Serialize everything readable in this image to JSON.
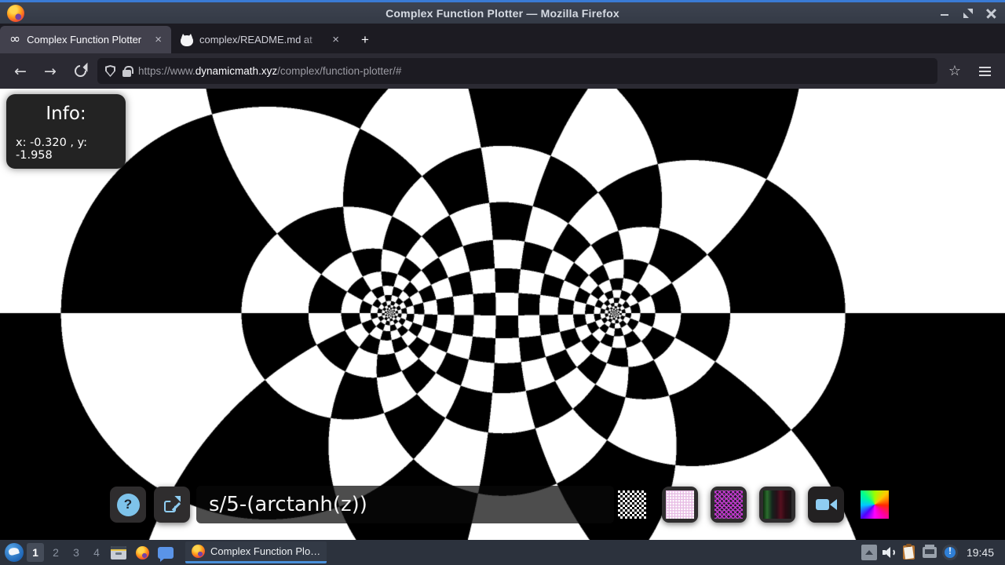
{
  "titlebar": {
    "title": "Complex Function Plotter — Mozilla Firefox"
  },
  "tabs": [
    {
      "title": "Complex Function Plotter",
      "icon": "infinity-icon",
      "close_label": "×"
    },
    {
      "title": "complex/README.md at",
      "icon": "github-icon",
      "close_label": "×"
    }
  ],
  "new_tab_label": "+",
  "navbar": {
    "url": {
      "scheme": "https://www.",
      "domain": "dynamicmath.xyz",
      "path": "/complex/function-plotter/#"
    }
  },
  "plotter": {
    "info_title": "Info:",
    "info_coords": "x: -0.320 , y: -1.958",
    "formula": "s/5-(arctanh(z))",
    "help_label": "?"
  },
  "taskbar": {
    "workspaces": [
      "1",
      "2",
      "3",
      "4"
    ],
    "active_workspace": "1",
    "window_title": "Complex Function Plo…",
    "clock": "19:45"
  },
  "colors": {
    "titlebar_accent": "#3a7bd5",
    "active_tab": "#42414d",
    "toolbar": "#2b2a33",
    "help_blue": "#7ec3ea",
    "icon_blue": "#8fcdf2",
    "task_underline": "#4a90d9",
    "plot_black": "#000000",
    "plot_white": "#ffffff"
  }
}
